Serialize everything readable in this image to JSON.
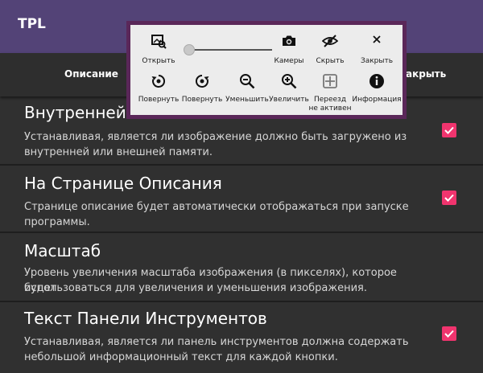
{
  "appbar": {
    "title": "TPL"
  },
  "tabs": {
    "left": "Описание",
    "right": "акрыть"
  },
  "settings": [
    {
      "title": "Внутренней Памяти",
      "desc1": "Устанавливая, является ли изображение должно быть загружено из",
      "desc2": "внутренней или внешней памяти.",
      "checked": true
    },
    {
      "title": "На Странице Описания",
      "desc1": "Странице описание будет автоматически отображаться при запуске",
      "desc2": "программы.",
      "checked": true
    },
    {
      "title": "Масштаб",
      "desc1": "Уровень увеличения масштаба изображения (в пикселях), которое будет",
      "desc2": "использоваться для увеличения и уменьшения изображения.",
      "checked": false
    },
    {
      "title": "Текст Панели Инструментов",
      "desc1": "Устанавливая, является ли панель инструментов должна содержать",
      "desc2": "небольшой информационный текст для каждой кнопки.",
      "checked": true
    }
  ],
  "toolbar": {
    "open": "Открыть",
    "camera": "Камеры",
    "hide": "Скрыть",
    "close": "Закрыть",
    "rotate_left": "Повернуть",
    "rotate_right": "Повернуть",
    "zoom_out": "Уменьшить",
    "zoom_in": "Увеличить",
    "move_line1": "Переезд",
    "move_line2": "не активен",
    "info": "Информация"
  },
  "colors": {
    "appbar": "#534377",
    "checkbox": "#f0346e",
    "popup_border": "#5a2759"
  }
}
